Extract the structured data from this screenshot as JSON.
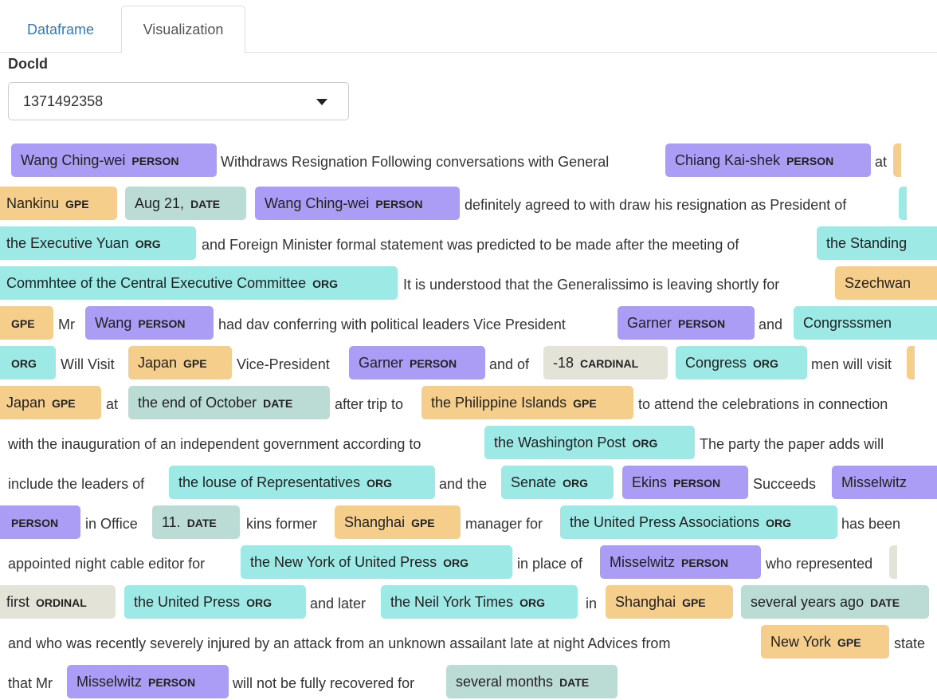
{
  "tabs": {
    "dataframe": "Dataframe",
    "visualization": "Visualization"
  },
  "docid": {
    "label": "DocId",
    "value": "1371492358"
  },
  "entity_colors": {
    "PERSON": "#ab9cf5",
    "GPE": "#f4ce8a",
    "DATE": "#bbdcd4",
    "ORG": "#9ce9e6",
    "CARDINAL": "#e3e3d7",
    "ORDINAL": "#e3e3d7"
  },
  "text": {
    "l1": {
      "e1": "Wang Ching-wei",
      "e1l": "PERSON",
      "t1": "Withdraws Resignation Following conversations with General",
      "e2": "Chiang Kai-shek",
      "e2l": "PERSON",
      "t2": "at"
    },
    "l2": {
      "e1": "Nankinu",
      "e1l": "GPE",
      "e2": "Aug 21,",
      "e2l": "DATE",
      "e3": "Wang Ching-wei",
      "e3l": "PERSON",
      "t1": "definitely agreed to with draw his resignation as President of"
    },
    "l3": {
      "e1": "the Executive Yuan",
      "e1l": "ORG",
      "t1": "and Foreign Minister formal statement was predicted to be made after the meeting of",
      "e2": "the Standing"
    },
    "l4": {
      "e1": "Commhtee of the Central Executive Committee",
      "e1l": "ORG",
      "t1": "It is understood that the Generalissimo is leaving shortly for",
      "e2": "Szechwan"
    },
    "l5": {
      "e1l": "GPE",
      "t1": "Mr",
      "e2": "Wang",
      "e2l": "PERSON",
      "t2": "had dav conferring with political leaders Vice President",
      "e3": "Garner",
      "e3l": "PERSON",
      "t3": "and",
      "e4": "Congrsssmen"
    },
    "l6": {
      "e1l": "ORG",
      "t1": "Will Visit",
      "e2": "Japan",
      "e2l": "GPE",
      "t2": "Vice-President",
      "e3": "Garner",
      "e3l": "PERSON",
      "t3": "and of",
      "e4": "-18",
      "e4l": "CARDINAL",
      "e5": "Congress",
      "e5l": "ORG",
      "t4": "men will visit"
    },
    "l7": {
      "e1": "Japan",
      "e1l": "GPE",
      "t1": "at",
      "e2": "the end of October",
      "e2l": "DATE",
      "t2": "after trip to",
      "e3": "the Philippine Islands",
      "e3l": "GPE",
      "t3": "to attend the celebrations in connection"
    },
    "l8": {
      "t1": "with the inauguration of an independent government according to",
      "e1": "the Washington Post",
      "e1l": "ORG",
      "t2": "The party the paper adds will"
    },
    "l9": {
      "t1": "include the leaders of",
      "e1": "the louse of Representatives",
      "e1l": "ORG",
      "t2": "and the",
      "e2": "Senate",
      "e2l": "ORG",
      "e3": "Ekins",
      "e3l": "PERSON",
      "t3": "Succeeds",
      "e4": "Misselwitz"
    },
    "l10": {
      "e1l": "PERSON",
      "t1": "in Office",
      "e2": "11.",
      "e2l": "DATE",
      "t2": "kins former",
      "e3": "Shanghai",
      "e3l": "GPE",
      "t3": "manager for",
      "e4": "the United Press Associations",
      "e4l": "ORG",
      "t4": "has been"
    },
    "l11": {
      "t1": "appointed night cable editor for",
      "e1": "the New York of United Press",
      "e1l": "ORG",
      "t2": "in place of",
      "e2": "Misselwitz",
      "e2l": "PERSON",
      "t3": "who represented"
    },
    "l12": {
      "e1": "first",
      "e1l": "ORDINAL",
      "e2": "the United Press",
      "e2l": "ORG",
      "t1": "and later",
      "e3": "the Neil York Times",
      "e3l": "ORG",
      "t2": "in",
      "e4": "Shanghai",
      "e4l": "GPE",
      "e5": "several years ago",
      "e5l": "DATE"
    },
    "l13": {
      "t1": "and who was recently severely injured by an attack from an unknown assailant late at night Advices from",
      "e1": "New York",
      "e1l": "GPE",
      "t2": "state"
    },
    "l14": {
      "t1": "that Mr",
      "e1": "Misselwitz",
      "e1l": "PERSON",
      "t2": "will not be fully recovered for",
      "e2": "several months",
      "e2l": "DATE"
    }
  }
}
